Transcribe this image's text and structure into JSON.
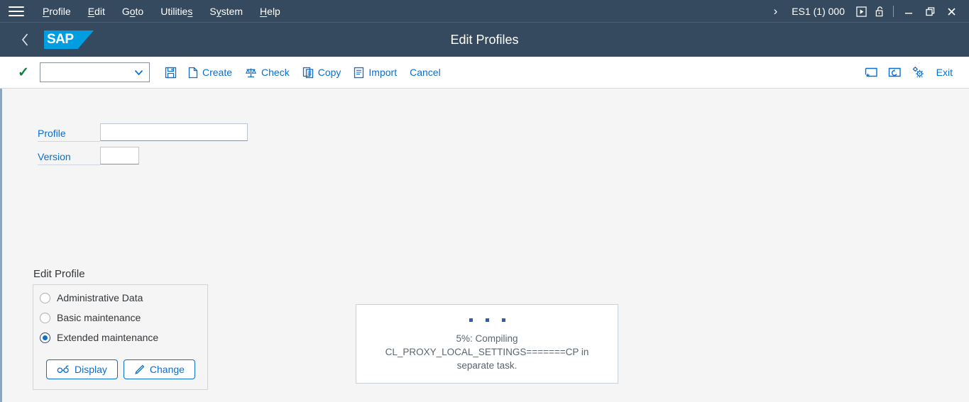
{
  "menubar": {
    "hamburger_icon": "hamburger-menu-icon",
    "items": [
      {
        "label": "Profile",
        "accel_index": 0
      },
      {
        "label": "Edit",
        "accel_index": 0
      },
      {
        "label": "Goto",
        "accel_index": 1
      },
      {
        "label": "Utilities",
        "accel_index": 7
      },
      {
        "label": "System",
        "accel_index": 1
      },
      {
        "label": "Help",
        "accel_index": 0
      }
    ],
    "chevron": "›",
    "system_info": "ES1 (1) 000",
    "icons": [
      "media-play-icon",
      "unlocked-padlock-icon"
    ],
    "window_controls": {
      "minimize": "—",
      "restore": "restore-window-icon",
      "close": "✕"
    }
  },
  "titlebar": {
    "back_icon": "‹",
    "logo_text": "SAP",
    "logo_color": "#009de0",
    "title": "Edit Profiles"
  },
  "toolbar": {
    "confirm_icon": "✓",
    "confirm_color": "#107e3e",
    "combo_value": "",
    "combo_placeholder": "",
    "combo_chevron": "▾",
    "save_label": "",
    "buttons": [
      {
        "label": "Create",
        "icon": "document-icon"
      },
      {
        "label": "Check",
        "icon": "balance-scales-icon"
      },
      {
        "label": "Copy",
        "icon": "copy-document-icon"
      },
      {
        "label": "Import",
        "icon": "import-document-icon"
      },
      {
        "label": "Cancel",
        "icon": ""
      }
    ],
    "right_buttons": [
      {
        "label": "",
        "icon": "new-window-favorite-icon"
      },
      {
        "label": "",
        "icon": "create-shortcut-icon"
      },
      {
        "label": "",
        "icon": "customize-gears-icon"
      },
      {
        "label": "Exit",
        "icon": ""
      }
    ],
    "accent_color": "#0a6ed1"
  },
  "form": {
    "profile": {
      "label": "Profile",
      "value": "",
      "placeholder": ""
    },
    "version": {
      "label": "Version",
      "value": "",
      "placeholder": ""
    }
  },
  "edit_profile": {
    "group_label": "Edit Profile",
    "options": [
      {
        "label": "Administrative Data",
        "selected": false
      },
      {
        "label": "Basic maintenance",
        "selected": false
      },
      {
        "label": "Extended maintenance",
        "selected": true
      }
    ],
    "buttons": [
      {
        "label": "Display",
        "icon": "glasses-icon"
      },
      {
        "label": "Change",
        "icon": "pencil-icon"
      }
    ]
  },
  "busy_dialog": {
    "dots": 3,
    "message": "5%: Compiling CL_PROXY_LOCAL_SETTINGS=======CP in separate task.",
    "progress_percent": "5%"
  }
}
